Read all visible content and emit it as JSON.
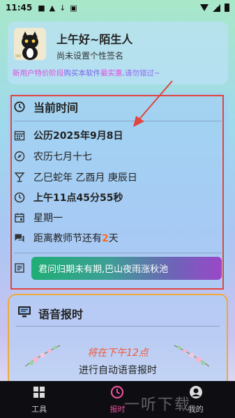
{
  "status_bar": {
    "time": "11:45",
    "icons": [
      "message-icon",
      "cat-icon",
      "download-icon",
      "a-icon",
      "wifi-icon",
      "signal-icon",
      "battery-icon"
    ]
  },
  "profile": {
    "greeting": "上午好~陌生人",
    "signature": "尚未设置个性签名",
    "promo_part1": "新用户特价阶段",
    "promo_part2": "购买本软件",
    "promo_part3": "最实惠",
    "promo_part4": ",请勿错过~"
  },
  "time_card": {
    "title": "当前时间",
    "gregorian_prefix": "公历",
    "gregorian_date": "2025年9月8日",
    "lunar": "农历七月十七",
    "ganzhi": "乙巳蛇年 乙酉月 庚辰日",
    "clock": "上午11点45分55秒",
    "weekday": "星期一",
    "holiday_prefix": "距离教师节还有",
    "holiday_days": "2",
    "holiday_suffix": "天",
    "poem": "君问归期未有期,巴山夜雨涨秋池"
  },
  "voice_card": {
    "title": "语音报时",
    "schedule": "将在下午12点",
    "auto_text": "进行自动语音报时"
  },
  "nav": {
    "items": [
      {
        "label": "工具",
        "icon": "tools-icon"
      },
      {
        "label": "报时",
        "icon": "clock-icon"
      },
      {
        "label": "我的",
        "icon": "profile-icon"
      }
    ]
  },
  "watermark": "一听下载",
  "colors": {
    "accent_orange": "#ff6a1a",
    "outline_red": "#e0453f",
    "nav_active": "#e8509a"
  }
}
